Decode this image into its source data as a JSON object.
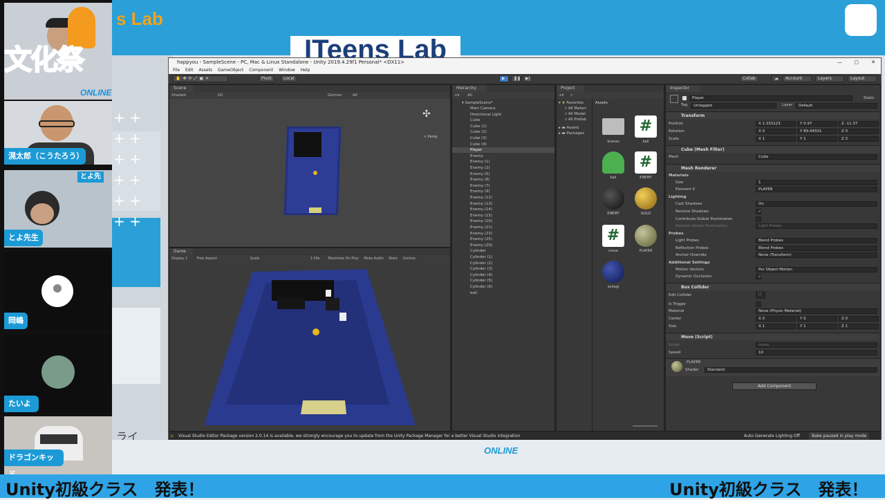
{
  "stage": {
    "brand_left": "s Lab",
    "brand_center": "ITeens Lab",
    "online_badge": "ONLINE",
    "side_text": "ライ"
  },
  "festival_logo": {
    "text": "文化祭",
    "sub": "ONLINE"
  },
  "participants": [
    {
      "name": "滉太郎（こうたろう）"
    },
    {
      "name": "とよ先生",
      "overlay_tag": "とよ先"
    },
    {
      "name": "岡嶋"
    },
    {
      "name": "たいよう"
    },
    {
      "name": "ドラゴンキッド"
    }
  ],
  "footer": {
    "left": "Unity初級クラス　発表！",
    "right": "Unity初級クラス　発表！"
  },
  "unity": {
    "title": "happyou - SampleScene - PC, Mac & Linux Standalone - Unity 2019.4.29f1 Personal* <DX11>",
    "menu": [
      "File",
      "Edit",
      "Assets",
      "GameObject",
      "Component",
      "Window",
      "Help"
    ],
    "toolbar": {
      "pivot": "Pivot",
      "local": "Local",
      "collab": "Collab",
      "account": "Account",
      "layers": "Layers",
      "layout": "Layout"
    },
    "scene": {
      "tab": "Scene",
      "shading": "Shaded",
      "mode": "2D",
      "gizmos": "Gizmos",
      "search": "All",
      "persp": "< Persp"
    },
    "game": {
      "tab": "Game",
      "display": "Display 1",
      "aspect": "Free Aspect",
      "scale_label": "Scale",
      "scale_value": "1.09x",
      "maximize": "Maximize On Play",
      "mute": "Mute Audio",
      "stats": "Stats",
      "gizmos": "Gizmos"
    },
    "hierarchy": {
      "tab": "Hierarchy",
      "search": "All",
      "scene_root": "SampleScene*",
      "items": [
        "Main Camera",
        "Directional Light",
        "Cube",
        "Cube (1)",
        "Cube (2)",
        "Cube (3)",
        "Cube (4)",
        "Player",
        "Enemy",
        "Enemy (1)",
        "Enemy (2)",
        "Enemy (5)",
        "Enemy (6)",
        "Enemy (7)",
        "Enemy (9)",
        "Enemy (12)",
        "Enemy (13)",
        "Enemy (14)",
        "Enemy (15)",
        "Enemy (16)",
        "Enemy (21)",
        "Enemy (23)",
        "Enemy (25)",
        "Enemy (29)",
        "Cylinder",
        "Cylinder (1)",
        "Cylinder (2)",
        "Cylinder (3)",
        "Cylinder (4)",
        "Cylinder (5)",
        "Cylinder (6)",
        "ball"
      ],
      "selected_index": 7
    },
    "project": {
      "tab": "Project",
      "favorites": "Favorites",
      "fav_items": [
        "All Materi",
        "All Model",
        "All Prefab"
      ],
      "folders": [
        "Assets",
        "Packages"
      ],
      "breadcrumb": "Assets",
      "assets": [
        {
          "name": "Scenes",
          "kind": "folder"
        },
        {
          "name": "ball",
          "kind": "script"
        },
        {
          "name": "ball",
          "kind": "prefab"
        },
        {
          "name": "ENEMY",
          "kind": "script"
        },
        {
          "name": "ENEMY",
          "kind": "material",
          "color": "#1a1a1a"
        },
        {
          "name": "GOLD",
          "kind": "material",
          "color": "#c89a20"
        },
        {
          "name": "move",
          "kind": "script"
        },
        {
          "name": "PLAYER",
          "kind": "material",
          "color": "#8a8a55"
        },
        {
          "name": "suhagi",
          "kind": "material",
          "color": "#1a2a7a"
        }
      ]
    },
    "inspector": {
      "tab": "Inspector",
      "object_name": "Player",
      "static": "Static",
      "tag_label": "Tag",
      "tag": "Untagged",
      "layer_label": "Layer",
      "layer": "Default",
      "transform": {
        "title": "Transform",
        "position_label": "Position",
        "position": [
          "1.333123",
          "0.97",
          "-11.37"
        ],
        "rotation_label": "Rotation",
        "rotation": [
          "0",
          "89.44501",
          "0"
        ],
        "scale_label": "Scale",
        "scale": [
          "1",
          "1",
          "3"
        ]
      },
      "mesh_filter": {
        "title": "Cube (Mesh Filter)",
        "mesh_label": "Mesh",
        "mesh": "Cube"
      },
      "mesh_renderer": {
        "title": "Mesh Renderer",
        "materials": "Materials",
        "size_label": "Size",
        "size": "1",
        "element_label": "Element 0",
        "element": "PLAYER",
        "lighting": "Lighting",
        "cast_shadows_label": "Cast Shadows",
        "cast_shadows": "On",
        "receive_shadows_label": "Receive Shadows",
        "contribute_gi_label": "Contribute Global Illumination",
        "receive_gi_label": "Receive Global Illumination",
        "receive_gi": "Light Probes",
        "probes": "Probes",
        "light_probes_label": "Light Probes",
        "light_probes": "Blend Probes",
        "reflection_probes_label": "Reflection Probes",
        "reflection_probes": "Blend Probes",
        "anchor_label": "Anchor Override",
        "anchor": "None (Transform)",
        "additional": "Additional Settings",
        "motion_label": "Motion Vectors",
        "motion": "Per Object Motion",
        "dynamic_occlusion_label": "Dynamic Occlusion"
      },
      "box_collider": {
        "title": "Box Collider",
        "edit_label": "Edit Collider",
        "trigger_label": "Is Trigger",
        "material_label": "Material",
        "material": "None (Physic Material)",
        "center_label": "Center",
        "center": [
          "0",
          "0",
          "0"
        ],
        "size_label": "Size",
        "size": [
          "1",
          "1",
          "1"
        ]
      },
      "move_script": {
        "title": "Move (Script)",
        "script_label": "Script",
        "script": "move",
        "speed_label": "Speed",
        "speed": "10"
      },
      "material": {
        "name": "PLAYER",
        "shader_label": "Shader",
        "shader": "Standard"
      },
      "add_component": "Add Component"
    },
    "status": {
      "warning": "Visual Studio Editor Package version 2.0.14 is available, we strongly encourage you to update from the Unity Package Manager for a better Visual Studio integration",
      "lighting": "Auto Generate Lighting Off",
      "bake": "Bake paused in play mode"
    }
  },
  "colors": {
    "accent": "#2ea4e6",
    "unity_dark": "#282828",
    "level_blue": "#2a3a8a"
  }
}
